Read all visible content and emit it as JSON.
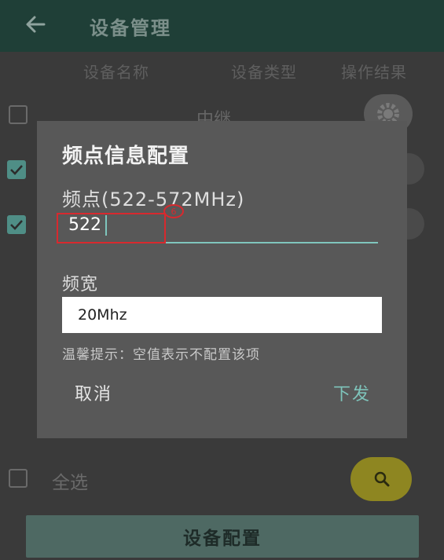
{
  "appbar": {
    "title": "设备管理",
    "back_icon": "arrow-left-icon"
  },
  "list": {
    "headers": [
      "设备名称",
      "设备类型",
      "操作结果"
    ],
    "rows": [
      {
        "name": "中继",
        "checked": false
      }
    ],
    "select_all_label": "全选"
  },
  "dialog": {
    "title": "频点信息配置",
    "freq_label": "频点(522-572MHz)",
    "freq_value": "522",
    "annotation_marker": "6",
    "bw_label": "频宽",
    "bw_value": "20Mhz",
    "hint": "温馨提示：空值表示不配置该项",
    "cancel_label": "取消",
    "send_label": "下发"
  },
  "footer": {
    "config_button_label": "设备配置"
  },
  "colors": {
    "appbar": "#1f3f37",
    "accent": "#7fc6bd",
    "fab": "#8e8621",
    "annotation": "#d8292e"
  }
}
